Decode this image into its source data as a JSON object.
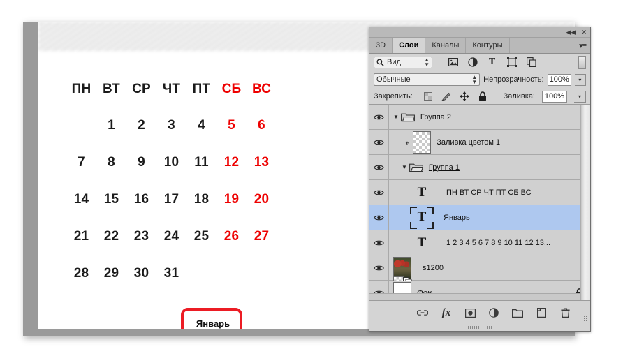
{
  "document": {
    "calendar": {
      "weekday_headers": [
        "ПН",
        "ВТ",
        "СР",
        "ЧТ",
        "ПТ",
        "СБ",
        "ВС"
      ],
      "weeks": [
        [
          "",
          "1",
          "2",
          "3",
          "4",
          "5",
          "6"
        ],
        [
          "7",
          "8",
          "9",
          "10",
          "11",
          "12",
          "13"
        ],
        [
          "14",
          "15",
          "16",
          "17",
          "18",
          "19",
          "20"
        ],
        [
          "21",
          "22",
          "23",
          "24",
          "25",
          "26",
          "27"
        ],
        [
          "28",
          "29",
          "30",
          "31",
          "",
          "",
          ""
        ]
      ],
      "weekend_columns": [
        5,
        6
      ],
      "month_label": "Январь",
      "weekday_color": "#1a1a1a",
      "weekend_color": "#ee0000",
      "highlight_ring_color": "#ec1c24"
    }
  },
  "panel": {
    "titlebar": {
      "collapse_icon": "◀◀",
      "close_icon": "✕"
    },
    "tabs": [
      {
        "label": "3D",
        "active": false
      },
      {
        "label": "Слои",
        "active": true
      },
      {
        "label": "Каналы",
        "active": false
      },
      {
        "label": "Контуры",
        "active": false
      }
    ],
    "panel_menu_icon": "▾≡",
    "filter_bar": {
      "kind_label": "Вид",
      "search_icon": "search-icon",
      "filter_icons": [
        "pixel-layer-icon",
        "adjustment-layer-icon",
        "type-layer-icon",
        "shape-layer-icon",
        "smart-object-icon"
      ]
    },
    "blend_row": {
      "blend_mode": "Обычные",
      "opacity_label": "Непрозрачность:",
      "opacity_value": "100%"
    },
    "lock_row": {
      "lock_label": "Закрепить:",
      "lock_icons": [
        "lock-transparency-icon",
        "lock-image-icon",
        "lock-position-icon",
        "lock-all-icon"
      ],
      "fill_label": "Заливка:",
      "fill_value": "100%"
    },
    "layers": [
      {
        "name": "Группа 2",
        "type": "group",
        "indent": 0,
        "expanded": true,
        "selected": false,
        "visible": true,
        "locked": false,
        "underline": false,
        "italic": false,
        "clipped": false
      },
      {
        "name": "Заливка цветом 1",
        "type": "fill",
        "indent": 1,
        "expanded": false,
        "selected": false,
        "visible": true,
        "locked": false,
        "underline": false,
        "italic": false,
        "clipped": true
      },
      {
        "name": "Группа 1",
        "type": "group",
        "indent": 1,
        "expanded": true,
        "selected": false,
        "visible": true,
        "locked": false,
        "underline": true,
        "italic": false,
        "clipped": false
      },
      {
        "name": "ПН ВТ СР ЧТ ПТ СБ ВС",
        "type": "text",
        "indent": 2,
        "expanded": false,
        "selected": false,
        "visible": true,
        "locked": false,
        "underline": false,
        "italic": false,
        "clipped": false
      },
      {
        "name": "Январь",
        "type": "text-selected",
        "indent": 2,
        "expanded": false,
        "selected": true,
        "visible": true,
        "locked": false,
        "underline": false,
        "italic": false,
        "clipped": false
      },
      {
        "name": "1 2 3 4 5 6 7 8 9 10 11 12 13...",
        "type": "text",
        "indent": 2,
        "expanded": false,
        "selected": false,
        "visible": true,
        "locked": false,
        "underline": false,
        "italic": false,
        "clipped": false
      },
      {
        "name": "s1200",
        "type": "smart",
        "indent": 0,
        "expanded": false,
        "selected": false,
        "visible": true,
        "locked": false,
        "underline": false,
        "italic": false,
        "clipped": false
      },
      {
        "name": "Фон",
        "type": "background",
        "indent": 0,
        "expanded": false,
        "selected": false,
        "visible": true,
        "locked": true,
        "underline": false,
        "italic": true,
        "clipped": false
      }
    ],
    "footer_icons": [
      "link-layers-icon",
      "fx-icon",
      "add-mask-icon",
      "new-adjustment-icon",
      "new-group-icon",
      "new-layer-icon",
      "delete-layer-icon"
    ],
    "selection_color": "#aec8ef"
  }
}
